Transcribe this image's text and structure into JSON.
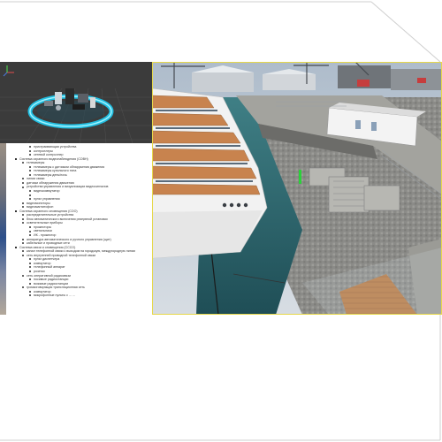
{
  "viewport3d": {
    "description_icon": "3d-viewport",
    "colors": {
      "sky": "#b9c8d6",
      "water": "#2f6f76",
      "pier": "#8a8a86",
      "ship_white": "#f2f2f2",
      "deck_wood": "#b07a4a",
      "selection_border": "#e6d84a"
    }
  },
  "document": {
    "lines": [
      {
        "indent": 3,
        "text": "пристраивающая устройства"
      },
      {
        "indent": 3,
        "text": "контроллеры"
      },
      {
        "indent": 3,
        "text": "сетевой контроллер"
      },
      {
        "indent": 1,
        "text": "Система охранного видеонаблюдения (СОВН)"
      },
      {
        "indent": 2,
        "text": "телекамеры"
      },
      {
        "indent": 3,
        "text": "телекамеры с датчиком обнаружения движения"
      },
      {
        "indent": 3,
        "text": "телекамеры купольного типа"
      },
      {
        "indent": 3,
        "text": "телекамеры день/ночь"
      },
      {
        "indent": 2,
        "text": "линии связи"
      },
      {
        "indent": 2,
        "text": "датчики обнаружения движения"
      },
      {
        "indent": 2,
        "text": "устройства управления и визуализации видеосигналов"
      },
      {
        "indent": 3,
        "text": "видеокоммутатор"
      },
      {
        "indent": 3,
        "text": ""
      },
      {
        "indent": 3,
        "text": "пульт управления"
      },
      {
        "indent": 2,
        "text": "видеомониторы"
      },
      {
        "indent": 2,
        "text": "видеомагнитофон"
      },
      {
        "indent": 1,
        "text": "Система охранного оповещения (СОО)"
      },
      {
        "indent": 2,
        "text": "распределительные устройства"
      },
      {
        "indent": 2,
        "text": "блок автоматического включения резервной установки"
      },
      {
        "indent": 2,
        "text": "осветительные приборы"
      },
      {
        "indent": 3,
        "text": "прожекторы"
      },
      {
        "indent": 3,
        "text": "светильники"
      },
      {
        "indent": 3,
        "text": "ИК - прожектор"
      },
      {
        "indent": 2,
        "text": "аппаратура автоматического и ручного управления (щит)"
      },
      {
        "indent": 2,
        "text": "кабельные и проводные сети"
      },
      {
        "indent": 1,
        "text": "Система связи и оповещения (СССО)"
      },
      {
        "indent": 2,
        "text": "канал телефонной связи с выходом на городскую, междугородную линии"
      },
      {
        "indent": 2,
        "text": "сеть внутренней проводной телефонной связи"
      },
      {
        "indent": 3,
        "text": "пульт диспетчера"
      },
      {
        "indent": 3,
        "text": "коммутатор"
      },
      {
        "indent": 3,
        "text": "телефонный аппарат"
      },
      {
        "indent": 3,
        "text": "розетки"
      },
      {
        "indent": 2,
        "text": "сеть оперативной радиосвязи"
      },
      {
        "indent": 3,
        "text": "носимые радиостанции"
      },
      {
        "indent": 3,
        "text": "возимые радиостанции"
      },
      {
        "indent": 2,
        "text": "громкоговорящая трансляционная сеть"
      },
      {
        "indent": 3,
        "text": "коммутатор"
      },
      {
        "indent": 3,
        "text": "микрофонные пульты с ... ..."
      }
    ]
  }
}
